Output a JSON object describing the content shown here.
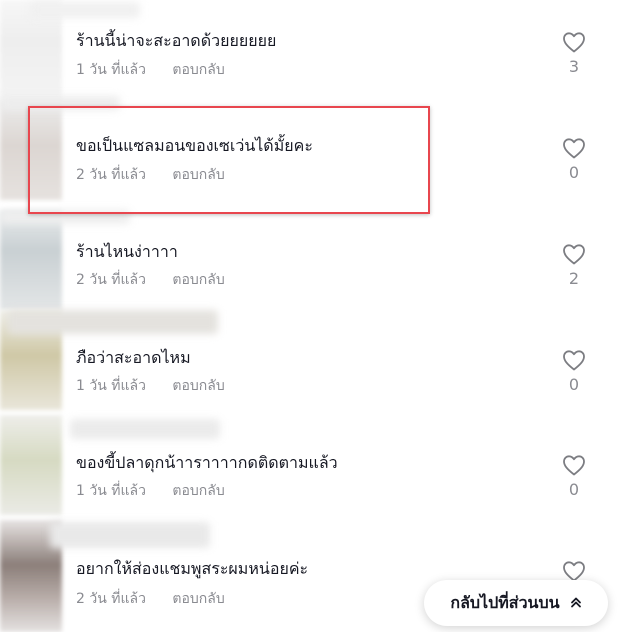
{
  "comments": [
    {
      "text": "ร้านนี้น่าจะสะอาดด้วยยยยยย",
      "time": "1 วัน ที่แล้ว",
      "reply": "ตอบกลับ",
      "likes": "3"
    },
    {
      "text": "ขอเป็นแซลมอนของเซเว่นได้มั้ยคะ",
      "time": "2 วัน ที่แล้ว",
      "reply": "ตอบกลับ",
      "likes": "0"
    },
    {
      "text": "ร้านไหนง่าาาา",
      "time": "2 วัน ที่แล้ว",
      "reply": "ตอบกลับ",
      "likes": "2"
    },
    {
      "text": "ภือว่าสะอาดไหม",
      "time": "1 วัน ที่แล้ว",
      "reply": "ตอบกลับ",
      "likes": "0"
    },
    {
      "text": "ของขี้ปลาดุกน้าาราาาากดติดตามแล้ว",
      "time": "1 วัน ที่แล้ว",
      "reply": "ตอบกลับ",
      "likes": "0"
    },
    {
      "text": "อยากให้ส่องแชมพูสระผมหน่อยค่ะ",
      "time": "2 วัน ที่แล้ว",
      "reply": "ตอบกลับ",
      "likes": ""
    }
  ],
  "back_to_top": {
    "label": "กลับไปที่ส่วนบน",
    "icon": "chevron-double-up-icon"
  },
  "colors": {
    "highlight": "#e8464e",
    "secondary_text": "#8a8b91",
    "primary_text": "#161823"
  }
}
